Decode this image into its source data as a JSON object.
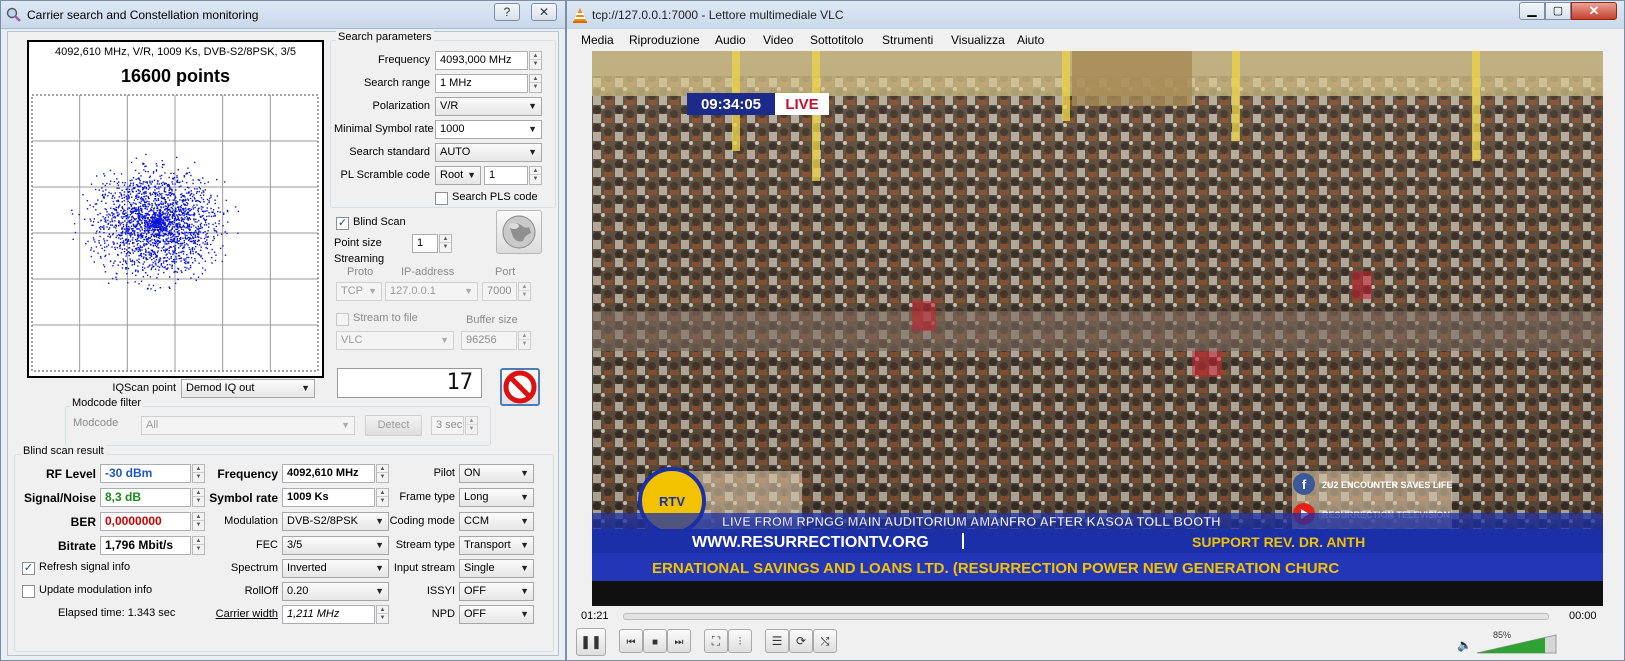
{
  "left_window": {
    "title": "Carrier search and Constellation monitoring",
    "help_glyph": "?",
    "close_glyph": "✕",
    "constellation": {
      "header": "4092,610 MHz, V/R, 1009 Ks, DVB-S2/8PSK, 3/5",
      "points_label": "16600 points"
    },
    "search_params": {
      "title": "Search parameters",
      "frequency_label": "Frequency",
      "frequency_value": "4093,000 MHz",
      "range_label": "Search range",
      "range_value": "1 MHz",
      "polarization_label": "Polarization",
      "polarization_value": "V/R",
      "min_sr_label": "Minimal Symbol rate",
      "min_sr_value": "1000",
      "standard_label": "Search standard",
      "standard_value": "AUTO",
      "pl_label": "PL Scramble code",
      "pl_mode": "Root",
      "pl_value": "1",
      "pls_label": "Search PLS code"
    },
    "blind_scan_label": "Blind Scan",
    "point_size_label": "Point size",
    "point_size_value": "1",
    "streaming": {
      "title": "Streaming",
      "proto_header": "Proto",
      "ip_header": "IP-address",
      "port_header": "Port",
      "proto_value": "TCP",
      "ip_value": "127.0.0.1",
      "port_value": "7000",
      "stream_to_file_label": "Stream to file",
      "buffer_label": "Buffer size",
      "player_value": "VLC",
      "buffer_value": "96256"
    },
    "lcd_value": "17",
    "iqscan_label": "IQScan point",
    "iqscan_value": "Demod IQ out",
    "modcode_filter": {
      "title": "Modcode filter",
      "label": "Modcode",
      "value": "All",
      "detect_label": "Detect",
      "sec_value": "3 sec"
    },
    "result": {
      "title": "Blind scan result",
      "rf_label": "RF Level",
      "rf_value": "-30 dBm",
      "sn_label": "Signal/Noise",
      "sn_value": "8,3 dB",
      "ber_label": "BER",
      "ber_value": "0,0000000",
      "bitrate_label": "Bitrate",
      "bitrate_value": "1,796 Mbit/s",
      "freq_label": "Frequency",
      "freq_value": "4092,610 MHz",
      "sr_label": "Symbol rate",
      "sr_value": "1009 Ks",
      "mod_label": "Modulation",
      "mod_value": "DVB-S2/8PSK",
      "fec_label": "FEC",
      "fec_value": "3/5",
      "spectrum_label": "Spectrum",
      "spectrum_value": "Inverted",
      "rolloff_label": "RollOff",
      "rolloff_value": "0.20",
      "cw_label": "Carrier width",
      "cw_value": "1,211 MHz",
      "pilot_label": "Pilot",
      "pilot_value": "ON",
      "frame_label": "Frame type",
      "frame_value": "Long",
      "coding_label": "Coding mode",
      "coding_value": "CCM",
      "stream_label": "Stream type",
      "stream_value": "Transport",
      "input_label": "Input stream",
      "input_value": "Single",
      "issyi_label": "ISSYI",
      "issyi_value": "OFF",
      "npd_label": "NPD",
      "npd_value": "OFF"
    },
    "refresh_label": "Refresh signal info",
    "update_mod_label": "Update modulation info",
    "elapsed_label": "Elapsed time:  1.343 sec"
  },
  "vlc": {
    "title": "tcp://127.0.0.1:7000 - Lettore multimediale VLC",
    "menu": [
      "Media",
      "Riproduzione",
      "Audio",
      "Video",
      "Sottotitolo",
      "Strumenti",
      "Visualizza",
      "Aiuto"
    ],
    "overlay_time": "09:34:05",
    "overlay_live": "LIVE",
    "ticker_top": "LIVE FROM RPNGG MAIN AUDITORIUM AMANFRO AFTER KASOA TOLL BOOTH",
    "ticker_url": "WWW.RESURRECTIONTV.ORG",
    "ticker_support": "SUPPORT  REV. DR. ANTH",
    "ticker_bottom": "ERNATIONAL SAVINGS AND LOANS LTD. (RESURRECTION POWER NEW GENERATION CHURC",
    "social_fb": "2U2 ENCOUNTER SAVES LIFE",
    "social_yt": "RESURRECTION TELEVISION",
    "time_elapsed": "01:21",
    "time_total": "00:00",
    "volume": "85%",
    "volume_level": 0.85
  },
  "colors": {
    "rf_value": "#1f57c3",
    "sn_value": "#1a8a1a",
    "ber_value": "#cc0000",
    "constellation_points": "#0a14d8",
    "ticker_blue": "#1a2fa8",
    "live_red": "#c8102e"
  }
}
